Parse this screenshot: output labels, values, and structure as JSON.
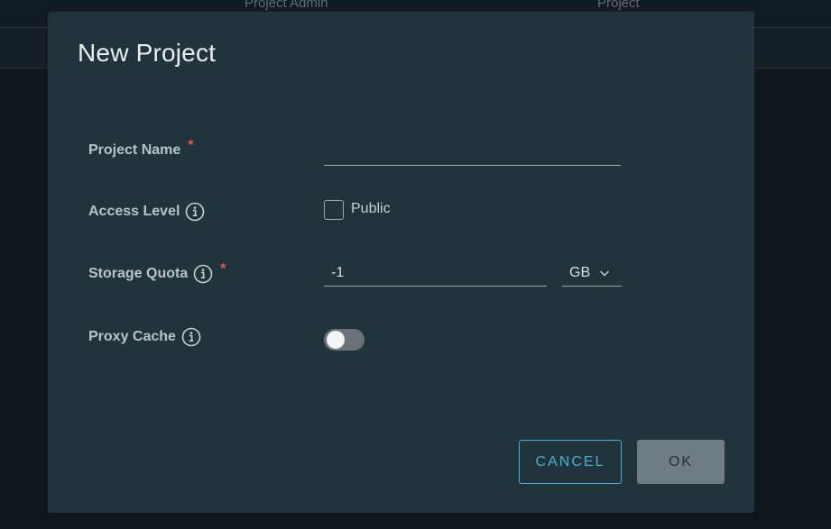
{
  "background": {
    "columns": [
      "Project Admin",
      "Project"
    ]
  },
  "dialog": {
    "title": "New Project",
    "project_name": {
      "label": "Project Name",
      "required_mark": "*",
      "value": ""
    },
    "access_level": {
      "label": "Access Level",
      "info_icon": "info-icon",
      "checkbox_label": "Public",
      "checked": false
    },
    "storage_quota": {
      "label": "Storage Quota",
      "info_icon": "info-icon",
      "required_mark": "*",
      "value": "-1",
      "unit": "GB"
    },
    "proxy_cache": {
      "label": "Proxy Cache",
      "info_icon": "info-icon",
      "enabled": false
    },
    "buttons": {
      "cancel": "CANCEL",
      "ok": "OK"
    }
  },
  "colors": {
    "accent": "#49afd9",
    "required": "#e35b48",
    "dialog_bg": "#21333b"
  }
}
